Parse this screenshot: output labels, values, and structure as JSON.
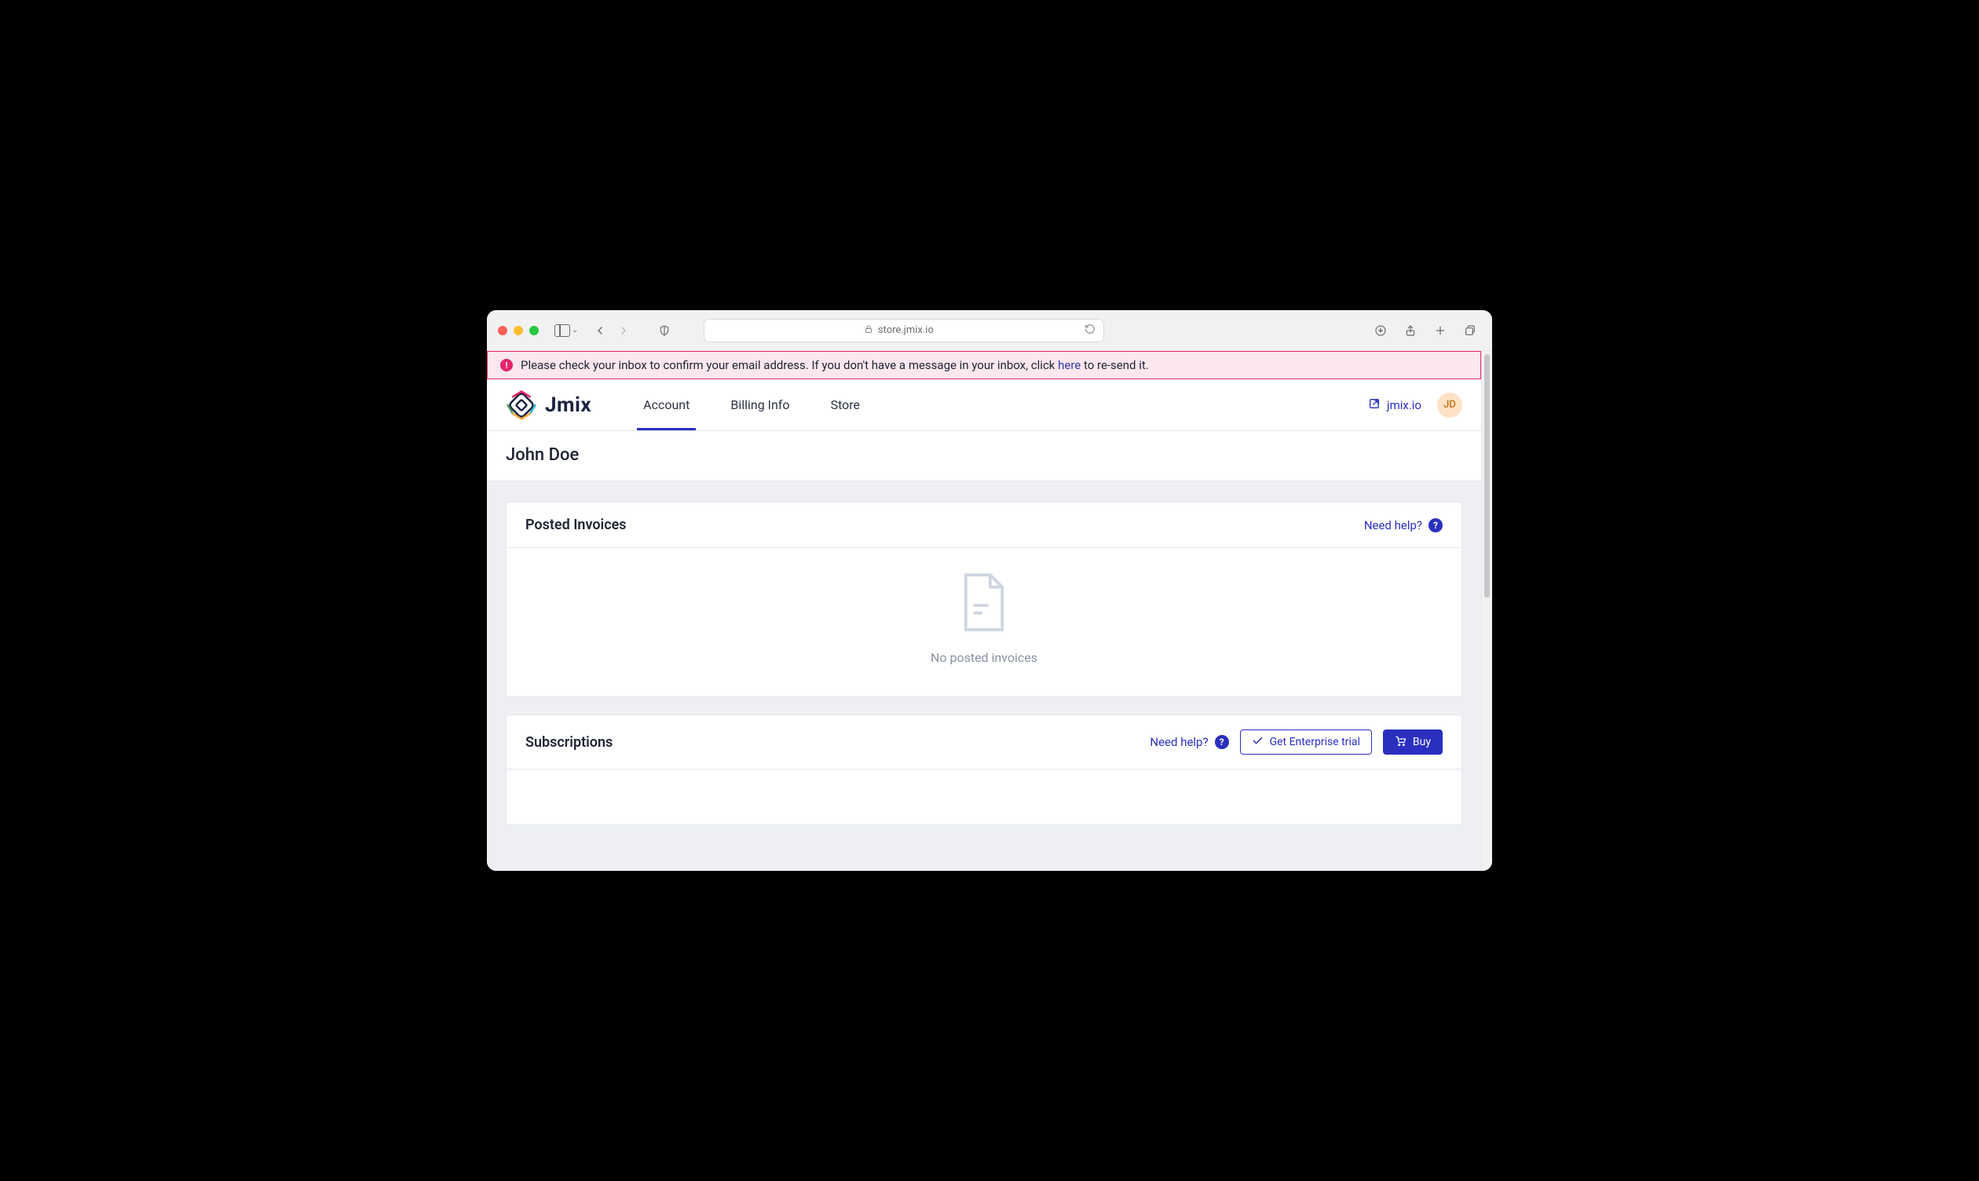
{
  "browser": {
    "url_display": "store.jmix.io"
  },
  "alert": {
    "text_before": "Please check your inbox to confirm your email address. If you don't have a message in your inbox, click ",
    "link_text": "here",
    "text_after": " to re-send it."
  },
  "header": {
    "logo_text": "Jmix",
    "tabs": [
      {
        "label": "Account",
        "active": true
      },
      {
        "label": "Billing Info",
        "active": false
      },
      {
        "label": "Store",
        "active": false
      }
    ],
    "external_link_label": "jmix.io",
    "avatar_initials": "JD"
  },
  "page": {
    "title": "John Doe"
  },
  "invoices_card": {
    "title": "Posted Invoices",
    "help_label": "Need help?",
    "empty_text": "No posted invoices"
  },
  "subscriptions_card": {
    "title": "Subscriptions",
    "help_label": "Need help?",
    "trial_button_label": "Get Enterprise trial",
    "buy_button_label": "Buy"
  }
}
